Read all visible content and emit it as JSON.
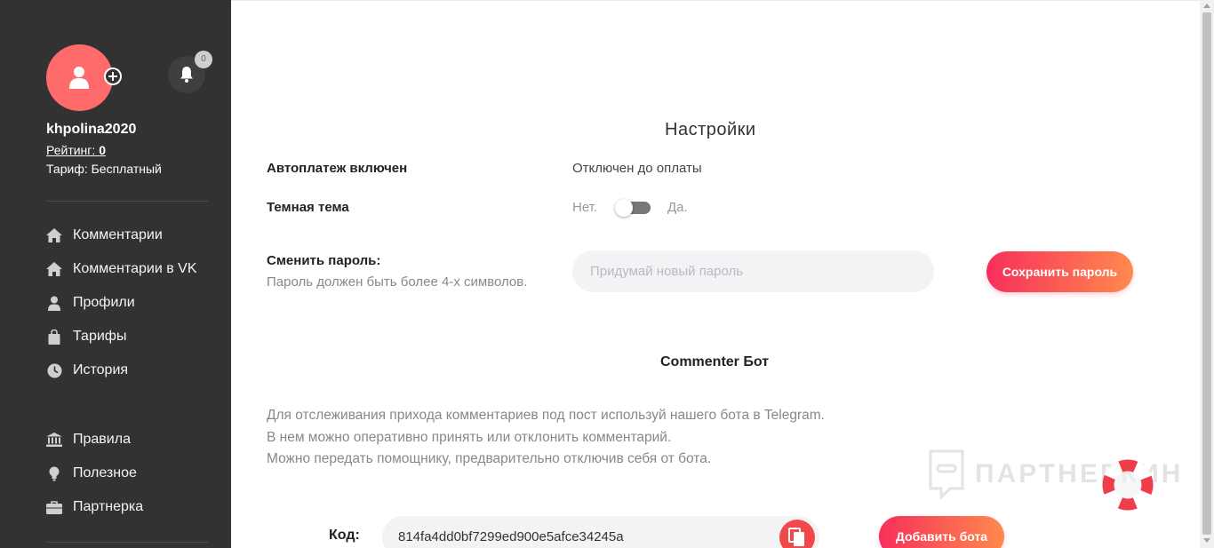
{
  "sidebar": {
    "username": "khpolina2020",
    "rating_label": "Рейтинг:",
    "rating_value": "0",
    "tariff": "Тариф: Бесплатный",
    "notifications_count": "0",
    "nav": [
      {
        "label": "Комментарии",
        "icon": "home-icon"
      },
      {
        "label": "Комментарии в VK",
        "icon": "home-icon"
      },
      {
        "label": "Профили",
        "icon": "user-icon"
      },
      {
        "label": "Тарифы",
        "icon": "bag-icon"
      },
      {
        "label": "История",
        "icon": "clock-icon"
      }
    ],
    "nav2": [
      {
        "label": "Правила",
        "icon": "bank-icon"
      },
      {
        "label": "Полезное",
        "icon": "bulb-icon"
      },
      {
        "label": "Партнерка",
        "icon": "briefcase-icon"
      }
    ]
  },
  "settings": {
    "title": "Настройки",
    "autopay_label": "Автоплатеж включен",
    "autopay_value": "Отключен до оплаты",
    "dark_theme_label": "Темная тема",
    "dark_no": "Нет.",
    "dark_yes": "Да.",
    "dark_theme_on": false,
    "password_label": "Сменить пароль",
    "password_hint": "Пароль должен быть более 4-х символов.",
    "password_placeholder": "Придумай новый пароль",
    "save_password": "Сохранить пароль"
  },
  "bot": {
    "title": "Commenter Бот",
    "desc_1": "Для отслеживания прихода комментариев под пост используй нашего бота в Telegram.",
    "desc_2": "В нем можно оперативно принять или отклонить комментарий.",
    "desc_3": "Можно передать помощнику, предварительно отключив себя от бота.",
    "code_label": "Код:",
    "code_value": "814fa4dd0bf7299ed900e5afce34245a",
    "add_bot": "Добавить бота"
  },
  "watermark": "ПАРТНЕРКИН",
  "colors": {
    "sidebar_bg": "#323232",
    "avatar": "#ff6b6b",
    "accent_start": "#f72f5b",
    "accent_end": "#ff8a4d"
  }
}
